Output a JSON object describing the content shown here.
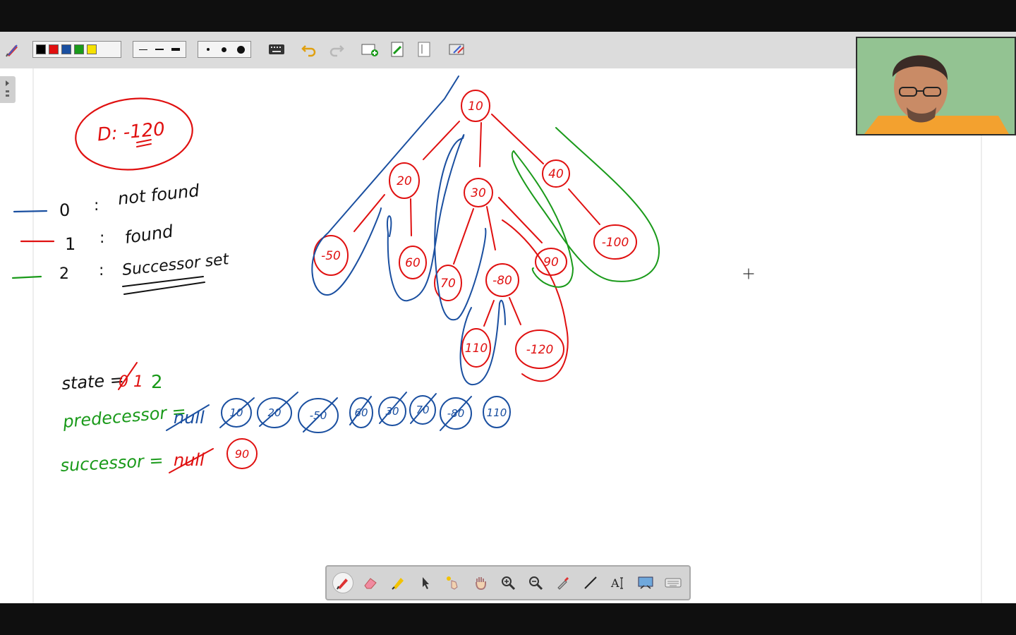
{
  "toolbar": {
    "colors": [
      "#000000",
      "#e01010",
      "#1a4fa0",
      "#1a9a1a",
      "#f5e100"
    ],
    "line_widths": [
      "thin",
      "medium",
      "thick"
    ],
    "dot_sizes": [
      "small",
      "medium",
      "large"
    ],
    "icons": [
      "pen-settings-icon",
      "keyboard-icon",
      "undo-icon",
      "redo-icon",
      "add-page-icon",
      "next-page-icon",
      "previous-page-icon",
      "eraser-settings-icon"
    ]
  },
  "draw_tools": [
    "pen-icon",
    "eraser-icon",
    "highlighter-icon",
    "pointer-icon",
    "laser-pointer-icon",
    "pan-hand-icon",
    "zoom-in-icon",
    "zoom-out-icon",
    "eyedropper-icon",
    "line-icon",
    "text-icon",
    "screen-capture-icon",
    "keyboard-icon"
  ],
  "board": {
    "d_box": "D: -120",
    "legend": [
      {
        "num": "0",
        "label": "not found",
        "color": "#1a4fa0"
      },
      {
        "num": "1",
        "label": "found",
        "color": "#e01010"
      },
      {
        "num": "2",
        "label": "Successor set",
        "color": "#1a9a1a"
      }
    ],
    "tree_nodes": [
      "10",
      "20",
      "30",
      "40",
      "-50",
      "60",
      "70",
      "-80",
      "90",
      "-100",
      "110",
      "-120"
    ],
    "state_label": "state =",
    "state_old": "0 1",
    "state_new": "2",
    "predecessor_label": "predecessor =",
    "predecessor_null": "null",
    "predecessor_values": [
      "10",
      "20",
      "-50",
      "60",
      "30",
      "70",
      "-80",
      "110"
    ],
    "successor_label": "successor =",
    "successor_null": "null",
    "successor_value": "90"
  }
}
